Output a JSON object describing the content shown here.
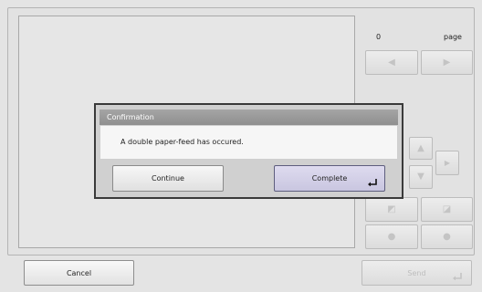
{
  "pager": {
    "page_number": "0",
    "page_unit": "page"
  },
  "dialog": {
    "title": "Confirmation",
    "message": "A double paper-feed has occured.",
    "continue_label": "Continue",
    "complete_label": "Complete"
  },
  "footer": {
    "cancel_label": "Cancel",
    "send_label": "Send"
  },
  "icons": {
    "prev": "triangle-left-icon",
    "next": "triangle-right-icon",
    "up": "triangle-up-icon",
    "down": "triangle-down-icon",
    "right": "triangle-right-icon",
    "rotate_left": "rotate-left-icon",
    "rotate_right": "rotate-right-icon",
    "zoom_out": "zoom-out-icon",
    "zoom_in": "zoom-in-icon",
    "enter": "enter-icon"
  },
  "colors": {
    "dialog_title_bg": "#9a9a9a",
    "complete_button_bg": "#d3d0e8",
    "background": "#e4e4e4"
  }
}
